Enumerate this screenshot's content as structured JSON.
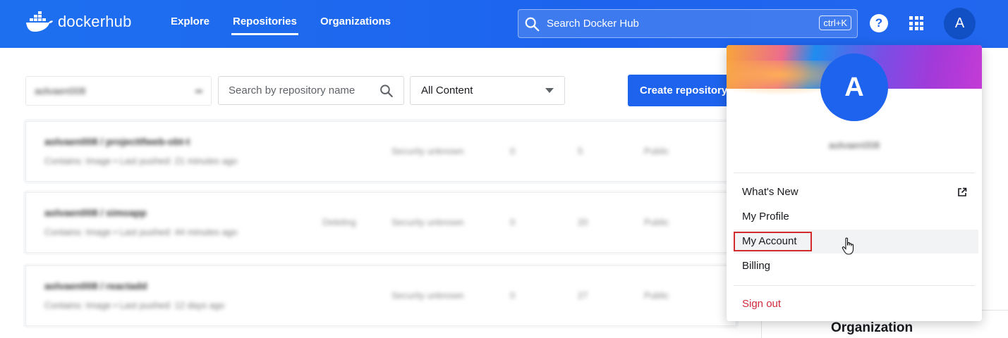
{
  "header": {
    "logo_text_1": "docker",
    "logo_text_2": "hub",
    "nav": [
      {
        "label": "Explore"
      },
      {
        "label": "Repositories"
      },
      {
        "label": "Organizations"
      }
    ],
    "search_placeholder": "Search Docker Hub",
    "search_shortcut": "ctrl+K",
    "help_icon": "?",
    "avatar_letter": "A"
  },
  "toolbar": {
    "namespace": "aolvaen008",
    "repo_search_placeholder": "Search by repository name",
    "filter_value": "All Content",
    "create_label": "Create repository"
  },
  "repos": [
    {
      "name": "aolvaen008 / projecttfweb-obt-t",
      "meta": "Contains: Image • Last pushed: 21 minutes ago",
      "status": "",
      "security": "Security unknown",
      "stars": "0",
      "pulls": "5",
      "visibility": "Public"
    },
    {
      "name": "aolvaen008 / simoapp",
      "meta": "Contains: Image • Last pushed: 44 minutes ago",
      "status": "Deleting",
      "security": "Security unknown",
      "stars": "0",
      "pulls": "20",
      "visibility": "Public"
    },
    {
      "name": "aolvaen008 / reactadd",
      "meta": "Contains: Image • Last pushed: 12 days ago",
      "status": "",
      "security": "Security unknown",
      "stars": "0",
      "pulls": "27",
      "visibility": "Public"
    }
  ],
  "account_menu": {
    "avatar_letter": "A",
    "username": "aolvaen008",
    "items": [
      {
        "label": "What's New"
      },
      {
        "label": "My Profile"
      },
      {
        "label": "My Account"
      },
      {
        "label": "Billing"
      }
    ],
    "sign_out": "Sign out"
  },
  "sidebar_partial": {
    "label": "Organization"
  }
}
